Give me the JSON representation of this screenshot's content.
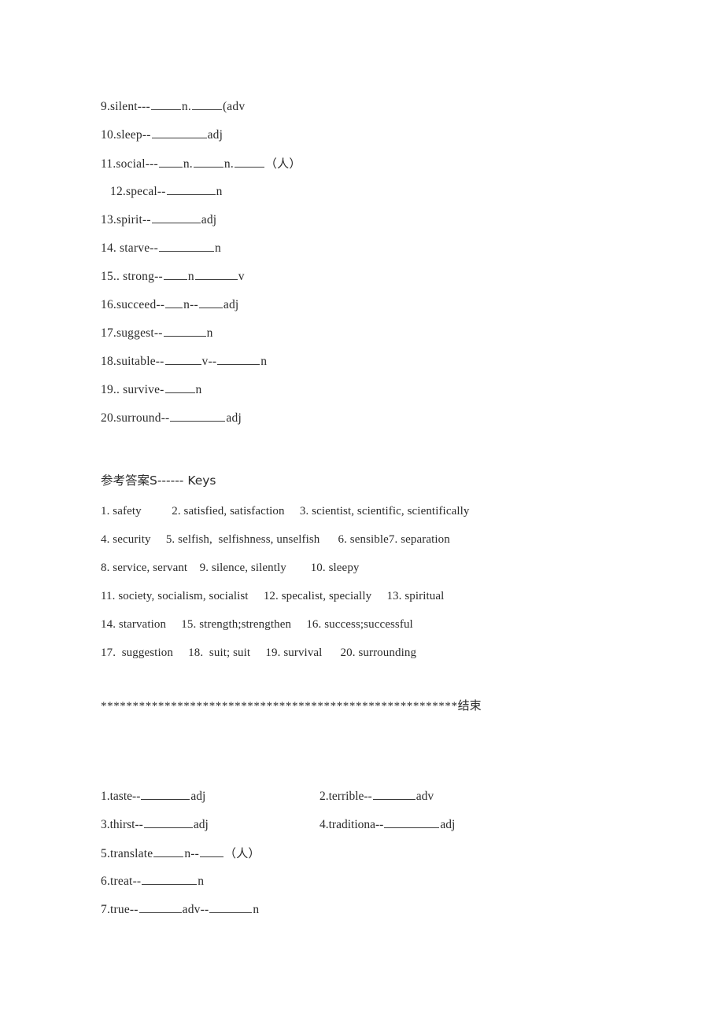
{
  "document": {
    "title": "Word Formation Exercise and Keys",
    "text_color": "#2b2b2b",
    "background_color": "#ffffff"
  },
  "exercise_top": {
    "items": [
      {
        "num": "9.",
        "word": "silent---",
        "tail_a": "n.",
        "tail_b": "(adv",
        "indent": false
      },
      {
        "num": "10.",
        "word": "sleep--",
        "tail_a": "adj",
        "indent": false
      },
      {
        "num": "11.",
        "word": "social---",
        "tail_a": "n.",
        "tail_b": "n.",
        "tail_c": "（人）",
        "indent": false
      },
      {
        "num": "12.",
        "word": "specal--",
        "tail_a": "n",
        "indent": true
      },
      {
        "num": "13.",
        "word": "spirit--",
        "tail_a": "adj",
        "indent": false
      },
      {
        "num": "14.",
        "word": " starve--",
        "tail_a": "n",
        "indent": false
      },
      {
        "num": "15.",
        "word": ". strong--",
        "tail_a": "n",
        "tail_b": "v",
        "indent": false
      },
      {
        "num": "16.",
        "word": "succeed--",
        "tail_a": "n",
        "mid": "--",
        "tail_b": "adj",
        "indent": false
      },
      {
        "num": "17.",
        "word": "suggest--",
        "tail_a": "n",
        "indent": false
      },
      {
        "num": "18.",
        "word": "suitable--",
        "tail_a": "v--",
        "tail_b": "n",
        "indent": false
      },
      {
        "num": "19.",
        "word": ". survive-",
        "tail_a": "n",
        "indent": false
      },
      {
        "num": "20.",
        "word": "surround--",
        "tail_a": "adj",
        "indent": false
      }
    ]
  },
  "keys": {
    "heading": "参考答案S------ Keys",
    "lines": [
      "1. safety          2. satisfied, satisfaction     3. scientist, scientific, scientifically",
      "4. security     5. selfish,  selfishness, unselfish      6. sensible7. separation",
      "8. service, servant    9. silence, silently        10. sleepy",
      "11. society, socialism, socialist     12. specalist, specially     13. spiritual",
      "14. starvation     15. strength;strengthen     16. success;successful",
      "17.  suggestion     18.  suit; suit     19. survival      20. surrounding"
    ]
  },
  "separator": {
    "stars": "********************************************************",
    "end_label": "结束"
  },
  "exercise_bottom": {
    "rows": [
      {
        "left": {
          "num": "1.",
          "word": "taste--",
          "tail_a": "adj"
        },
        "right": {
          "num": "2.",
          "word": "terrible--",
          "tail_a": "adv"
        }
      },
      {
        "left": {
          "num": "3.",
          "word": "thirst--",
          "tail_a": "adj"
        },
        "right": {
          "num": "4.",
          "word": "traditiona--",
          "tail_a": "adj"
        }
      }
    ],
    "single_items": [
      {
        "num": "5.",
        "word": "translate",
        "tail_a": "n--",
        "tail_b": "（人）"
      },
      {
        "num": "6.",
        "word": "treat--",
        "tail_a": "n"
      },
      {
        "num": "7.",
        "word": "true--",
        "tail_a": "adv--",
        "tail_b": "n"
      }
    ]
  }
}
